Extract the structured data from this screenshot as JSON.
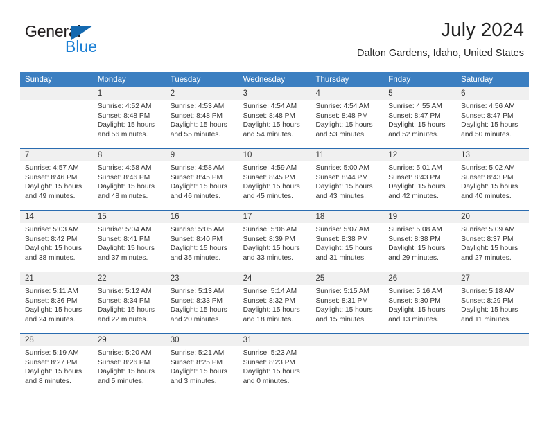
{
  "logo": {
    "text_top": "General",
    "text_bottom": "Blue",
    "triangle_color": "#1469b0",
    "blue_color": "#1b7fd4"
  },
  "header": {
    "title": "July 2024",
    "subtitle": "Dalton Gardens, Idaho, United States"
  },
  "theme": {
    "header_bg": "#3c7fc1",
    "header_text": "#ffffff",
    "daynum_bg": "#f0f0f0",
    "week_divider": "#2a6cb0",
    "body_text": "#333333"
  },
  "weekdays": [
    "Sunday",
    "Monday",
    "Tuesday",
    "Wednesday",
    "Thursday",
    "Friday",
    "Saturday"
  ],
  "weeks": [
    [
      {
        "day": "",
        "sunrise": "",
        "sunset": "",
        "daylight1": "",
        "daylight2": ""
      },
      {
        "day": "1",
        "sunrise": "Sunrise: 4:52 AM",
        "sunset": "Sunset: 8:48 PM",
        "daylight1": "Daylight: 15 hours",
        "daylight2": "and 56 minutes."
      },
      {
        "day": "2",
        "sunrise": "Sunrise: 4:53 AM",
        "sunset": "Sunset: 8:48 PM",
        "daylight1": "Daylight: 15 hours",
        "daylight2": "and 55 minutes."
      },
      {
        "day": "3",
        "sunrise": "Sunrise: 4:54 AM",
        "sunset": "Sunset: 8:48 PM",
        "daylight1": "Daylight: 15 hours",
        "daylight2": "and 54 minutes."
      },
      {
        "day": "4",
        "sunrise": "Sunrise: 4:54 AM",
        "sunset": "Sunset: 8:48 PM",
        "daylight1": "Daylight: 15 hours",
        "daylight2": "and 53 minutes."
      },
      {
        "day": "5",
        "sunrise": "Sunrise: 4:55 AM",
        "sunset": "Sunset: 8:47 PM",
        "daylight1": "Daylight: 15 hours",
        "daylight2": "and 52 minutes."
      },
      {
        "day": "6",
        "sunrise": "Sunrise: 4:56 AM",
        "sunset": "Sunset: 8:47 PM",
        "daylight1": "Daylight: 15 hours",
        "daylight2": "and 50 minutes."
      }
    ],
    [
      {
        "day": "7",
        "sunrise": "Sunrise: 4:57 AM",
        "sunset": "Sunset: 8:46 PM",
        "daylight1": "Daylight: 15 hours",
        "daylight2": "and 49 minutes."
      },
      {
        "day": "8",
        "sunrise": "Sunrise: 4:58 AM",
        "sunset": "Sunset: 8:46 PM",
        "daylight1": "Daylight: 15 hours",
        "daylight2": "and 48 minutes."
      },
      {
        "day": "9",
        "sunrise": "Sunrise: 4:58 AM",
        "sunset": "Sunset: 8:45 PM",
        "daylight1": "Daylight: 15 hours",
        "daylight2": "and 46 minutes."
      },
      {
        "day": "10",
        "sunrise": "Sunrise: 4:59 AM",
        "sunset": "Sunset: 8:45 PM",
        "daylight1": "Daylight: 15 hours",
        "daylight2": "and 45 minutes."
      },
      {
        "day": "11",
        "sunrise": "Sunrise: 5:00 AM",
        "sunset": "Sunset: 8:44 PM",
        "daylight1": "Daylight: 15 hours",
        "daylight2": "and 43 minutes."
      },
      {
        "day": "12",
        "sunrise": "Sunrise: 5:01 AM",
        "sunset": "Sunset: 8:43 PM",
        "daylight1": "Daylight: 15 hours",
        "daylight2": "and 42 minutes."
      },
      {
        "day": "13",
        "sunrise": "Sunrise: 5:02 AM",
        "sunset": "Sunset: 8:43 PM",
        "daylight1": "Daylight: 15 hours",
        "daylight2": "and 40 minutes."
      }
    ],
    [
      {
        "day": "14",
        "sunrise": "Sunrise: 5:03 AM",
        "sunset": "Sunset: 8:42 PM",
        "daylight1": "Daylight: 15 hours",
        "daylight2": "and 38 minutes."
      },
      {
        "day": "15",
        "sunrise": "Sunrise: 5:04 AM",
        "sunset": "Sunset: 8:41 PM",
        "daylight1": "Daylight: 15 hours",
        "daylight2": "and 37 minutes."
      },
      {
        "day": "16",
        "sunrise": "Sunrise: 5:05 AM",
        "sunset": "Sunset: 8:40 PM",
        "daylight1": "Daylight: 15 hours",
        "daylight2": "and 35 minutes."
      },
      {
        "day": "17",
        "sunrise": "Sunrise: 5:06 AM",
        "sunset": "Sunset: 8:39 PM",
        "daylight1": "Daylight: 15 hours",
        "daylight2": "and 33 minutes."
      },
      {
        "day": "18",
        "sunrise": "Sunrise: 5:07 AM",
        "sunset": "Sunset: 8:38 PM",
        "daylight1": "Daylight: 15 hours",
        "daylight2": "and 31 minutes."
      },
      {
        "day": "19",
        "sunrise": "Sunrise: 5:08 AM",
        "sunset": "Sunset: 8:38 PM",
        "daylight1": "Daylight: 15 hours",
        "daylight2": "and 29 minutes."
      },
      {
        "day": "20",
        "sunrise": "Sunrise: 5:09 AM",
        "sunset": "Sunset: 8:37 PM",
        "daylight1": "Daylight: 15 hours",
        "daylight2": "and 27 minutes."
      }
    ],
    [
      {
        "day": "21",
        "sunrise": "Sunrise: 5:11 AM",
        "sunset": "Sunset: 8:36 PM",
        "daylight1": "Daylight: 15 hours",
        "daylight2": "and 24 minutes."
      },
      {
        "day": "22",
        "sunrise": "Sunrise: 5:12 AM",
        "sunset": "Sunset: 8:34 PM",
        "daylight1": "Daylight: 15 hours",
        "daylight2": "and 22 minutes."
      },
      {
        "day": "23",
        "sunrise": "Sunrise: 5:13 AM",
        "sunset": "Sunset: 8:33 PM",
        "daylight1": "Daylight: 15 hours",
        "daylight2": "and 20 minutes."
      },
      {
        "day": "24",
        "sunrise": "Sunrise: 5:14 AM",
        "sunset": "Sunset: 8:32 PM",
        "daylight1": "Daylight: 15 hours",
        "daylight2": "and 18 minutes."
      },
      {
        "day": "25",
        "sunrise": "Sunrise: 5:15 AM",
        "sunset": "Sunset: 8:31 PM",
        "daylight1": "Daylight: 15 hours",
        "daylight2": "and 15 minutes."
      },
      {
        "day": "26",
        "sunrise": "Sunrise: 5:16 AM",
        "sunset": "Sunset: 8:30 PM",
        "daylight1": "Daylight: 15 hours",
        "daylight2": "and 13 minutes."
      },
      {
        "day": "27",
        "sunrise": "Sunrise: 5:18 AM",
        "sunset": "Sunset: 8:29 PM",
        "daylight1": "Daylight: 15 hours",
        "daylight2": "and 11 minutes."
      }
    ],
    [
      {
        "day": "28",
        "sunrise": "Sunrise: 5:19 AM",
        "sunset": "Sunset: 8:27 PM",
        "daylight1": "Daylight: 15 hours",
        "daylight2": "and 8 minutes."
      },
      {
        "day": "29",
        "sunrise": "Sunrise: 5:20 AM",
        "sunset": "Sunset: 8:26 PM",
        "daylight1": "Daylight: 15 hours",
        "daylight2": "and 5 minutes."
      },
      {
        "day": "30",
        "sunrise": "Sunrise: 5:21 AM",
        "sunset": "Sunset: 8:25 PM",
        "daylight1": "Daylight: 15 hours",
        "daylight2": "and 3 minutes."
      },
      {
        "day": "31",
        "sunrise": "Sunrise: 5:23 AM",
        "sunset": "Sunset: 8:23 PM",
        "daylight1": "Daylight: 15 hours",
        "daylight2": "and 0 minutes."
      },
      {
        "day": "",
        "sunrise": "",
        "sunset": "",
        "daylight1": "",
        "daylight2": ""
      },
      {
        "day": "",
        "sunrise": "",
        "sunset": "",
        "daylight1": "",
        "daylight2": ""
      },
      {
        "day": "",
        "sunrise": "",
        "sunset": "",
        "daylight1": "",
        "daylight2": ""
      }
    ]
  ]
}
